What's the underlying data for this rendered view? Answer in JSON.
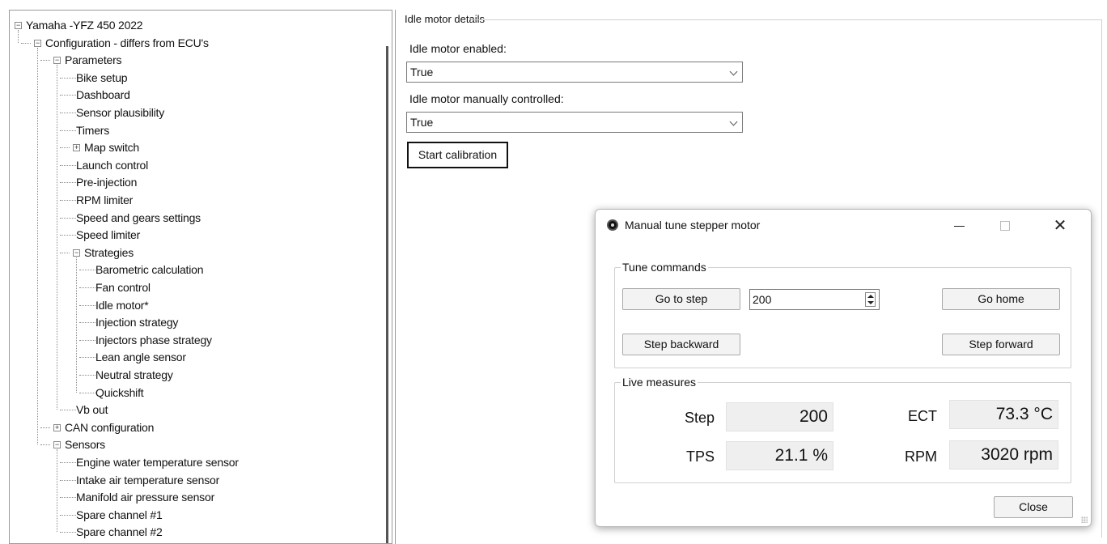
{
  "tree": {
    "items": [
      {
        "label": "Yamaha -YFZ 450 2022",
        "level": 0,
        "expander": "−"
      },
      {
        "label": "Configuration - differs from ECU's",
        "level": 1,
        "expander": "−"
      },
      {
        "label": "Parameters",
        "level": 2,
        "expander": "−"
      },
      {
        "label": "Bike setup",
        "level": 3,
        "expander": ""
      },
      {
        "label": "Dashboard",
        "level": 3,
        "expander": ""
      },
      {
        "label": "Sensor plausibility",
        "level": 3,
        "expander": ""
      },
      {
        "label": "Timers",
        "level": 3,
        "expander": ""
      },
      {
        "label": "Map switch",
        "level": 3,
        "expander": "+"
      },
      {
        "label": "Launch control",
        "level": 3,
        "expander": ""
      },
      {
        "label": "Pre-injection",
        "level": 3,
        "expander": ""
      },
      {
        "label": "RPM limiter",
        "level": 3,
        "expander": ""
      },
      {
        "label": "Speed and gears settings",
        "level": 3,
        "expander": ""
      },
      {
        "label": "Speed limiter",
        "level": 3,
        "expander": ""
      },
      {
        "label": "Strategies",
        "level": 3,
        "expander": "−"
      },
      {
        "label": "Barometric calculation",
        "level": 4,
        "expander": ""
      },
      {
        "label": "Fan control",
        "level": 4,
        "expander": ""
      },
      {
        "label": "Idle motor*",
        "level": 4,
        "expander": ""
      },
      {
        "label": "Injection strategy",
        "level": 4,
        "expander": ""
      },
      {
        "label": "Injectors phase strategy",
        "level": 4,
        "expander": ""
      },
      {
        "label": "Lean angle sensor",
        "level": 4,
        "expander": ""
      },
      {
        "label": "Neutral strategy",
        "level": 4,
        "expander": ""
      },
      {
        "label": "Quickshift",
        "level": 4,
        "expander": ""
      },
      {
        "label": "Vb out",
        "level": 3,
        "expander": ""
      },
      {
        "label": "CAN configuration",
        "level": 2,
        "expander": "+"
      },
      {
        "label": "Sensors",
        "level": 2,
        "expander": "−"
      },
      {
        "label": "Engine water temperature sensor",
        "level": 3,
        "expander": ""
      },
      {
        "label": "Intake air temperature sensor",
        "level": 3,
        "expander": ""
      },
      {
        "label": "Manifold air pressure sensor",
        "level": 3,
        "expander": ""
      },
      {
        "label": "Spare channel #1",
        "level": 3,
        "expander": ""
      },
      {
        "label": "Spare channel #2",
        "level": 3,
        "expander": ""
      }
    ]
  },
  "details": {
    "group_title": "Idle motor details",
    "enabled_label": "Idle motor enabled:",
    "enabled_value": "True",
    "manual_label": "Idle motor manually controlled:",
    "manual_value": "True",
    "calibration_button": "Start calibration"
  },
  "dialog": {
    "title": "Manual tune stepper motor",
    "close_glyph": "✕",
    "tune_group_title": "Tune commands",
    "go_to_step": "Go to step",
    "step_value": "200",
    "go_home": "Go home",
    "step_backward": "Step backward",
    "step_forward": "Step forward",
    "live_group_title": "Live measures",
    "measures": {
      "step_label": "Step",
      "step_value": "200",
      "ect_label": "ECT",
      "ect_value": "73.3 °C",
      "tps_label": "TPS",
      "tps_value": "21.1 %",
      "rpm_label": "RPM",
      "rpm_value": "3020 rpm"
    },
    "close_button": "Close"
  }
}
